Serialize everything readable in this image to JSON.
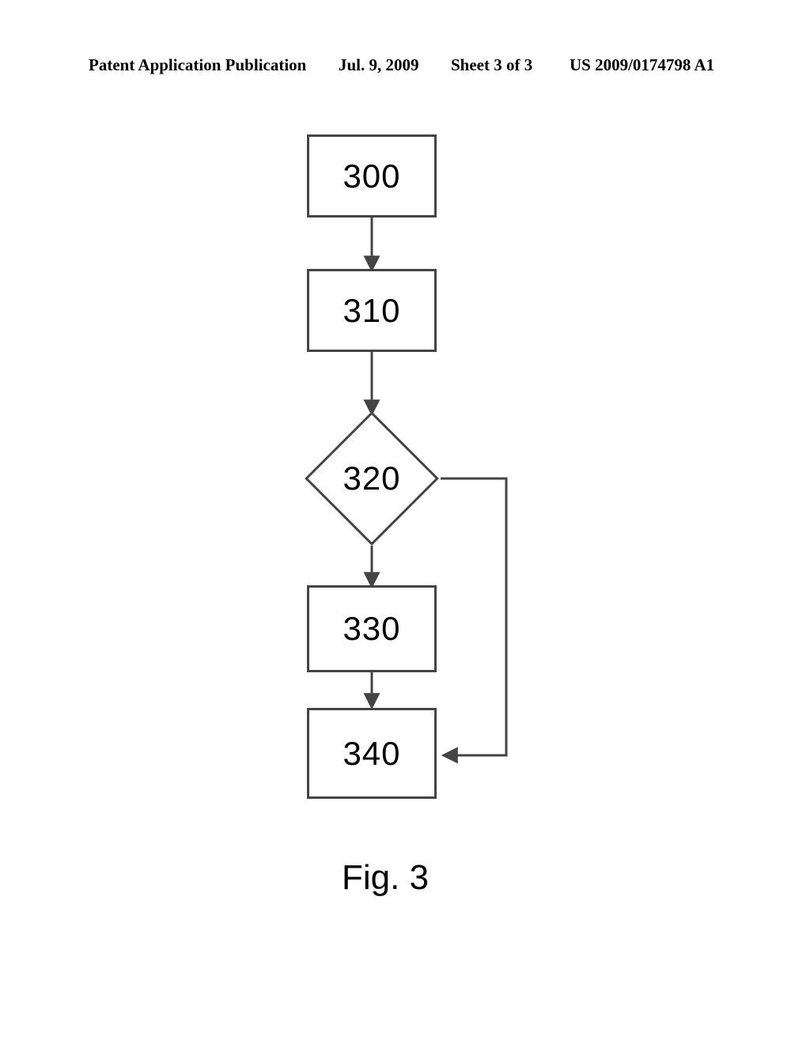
{
  "header": {
    "publication": "Patent Application Publication",
    "date": "Jul. 9, 2009",
    "sheet": "Sheet 3 of 3",
    "docnumber": "US 2009/0174798 A1"
  },
  "flowchart": {
    "nodes": {
      "n300": "300",
      "n310": "310",
      "n320": "320",
      "n330": "330",
      "n340": "340"
    },
    "caption": "Fig. 3"
  }
}
